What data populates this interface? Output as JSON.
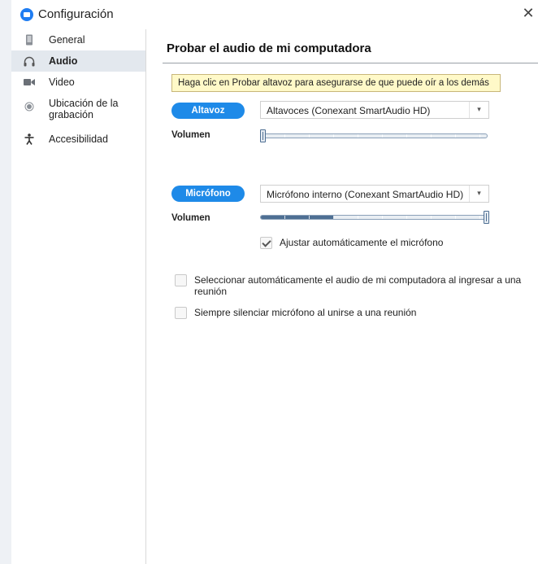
{
  "window": {
    "title": "Configuración",
    "close_glyph": "✕"
  },
  "sidebar": {
    "items": [
      {
        "label": "General",
        "icon": "phone-icon",
        "active": false
      },
      {
        "label": "Audio",
        "icon": "headphones-icon",
        "active": true
      },
      {
        "label": "Video",
        "icon": "video-camera-icon",
        "active": false
      },
      {
        "label": "Ubicación de la grabación",
        "icon": "record-icon",
        "active": false
      },
      {
        "label": "Accesibilidad",
        "icon": "accessibility-icon",
        "active": false
      }
    ]
  },
  "main": {
    "section_title": "Probar el audio de mi computadora",
    "tooltip": "Haga clic en Probar altavoz para asegurarse de que puede oír a los demás",
    "speaker": {
      "button_label": "Altavoz",
      "device": "Altavoces (Conexant SmartAudio HD)",
      "volume_label": "Volumen",
      "volume_level": 0.0,
      "activity_level": 0.0
    },
    "microphone": {
      "button_label": "Micrófono",
      "device": "Micrófono interno (Conexant SmartAudio HD)",
      "volume_label": "Volumen",
      "volume_level": 1.0,
      "activity_level": 0.32
    },
    "auto_adjust": {
      "label": "Ajustar automáticamente el micrófono",
      "checked": true
    },
    "auto_select": {
      "label": "Seleccionar automáticamente el audio de mi computadora al ingresar a una reunión",
      "checked": false
    },
    "mute_on_join": {
      "label": "Siempre silenciar micrófono al unirse a una reunión",
      "checked": false
    }
  },
  "colors": {
    "accent": "#1e8ae8",
    "sidebar_active": "#e3e8ee",
    "tooltip_bg": "#fff9c8",
    "slider_fill": "#4e6f93"
  }
}
